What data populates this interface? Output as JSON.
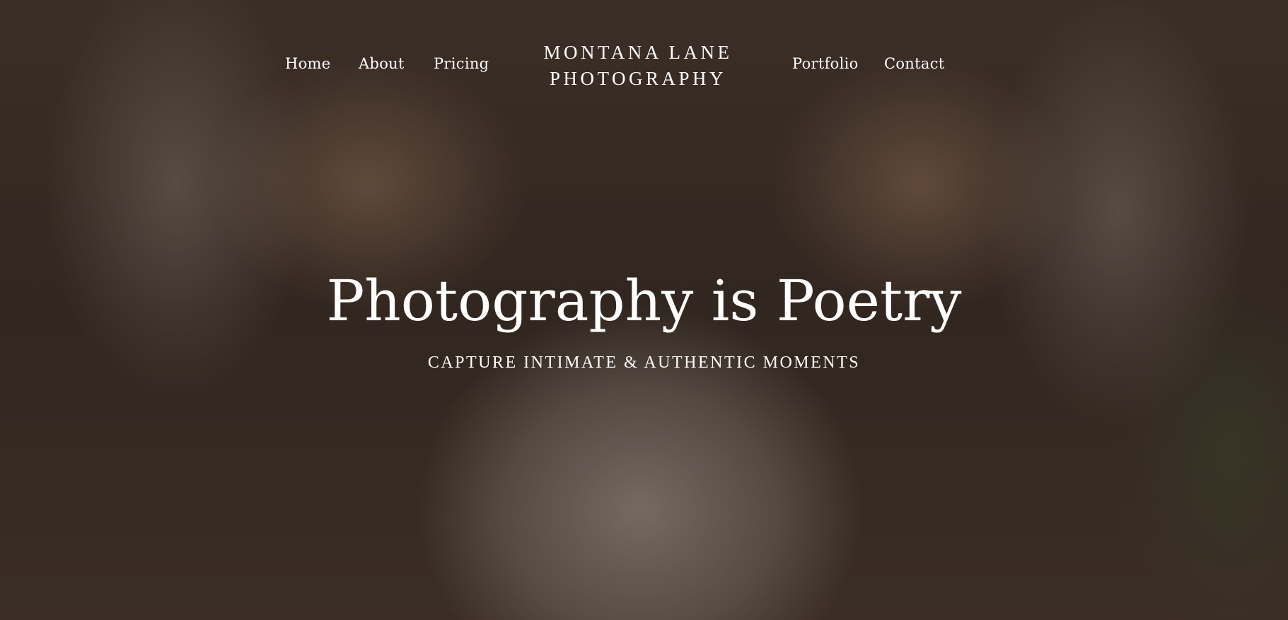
{
  "brand": {
    "line1": "MONTANA LANE",
    "line2": "PHOTOGRAPHY"
  },
  "nav": {
    "home": "Home",
    "about": "About",
    "pricing": "Pricing",
    "portfolio": "Portfolio",
    "contact": "Contact"
  },
  "hero": {
    "headline": "Photography is Poetry",
    "subheadline": "CAPTURE INTIMATE & AUTHENTIC MOMENTS"
  },
  "colors": {
    "text": "#ffffff"
  }
}
